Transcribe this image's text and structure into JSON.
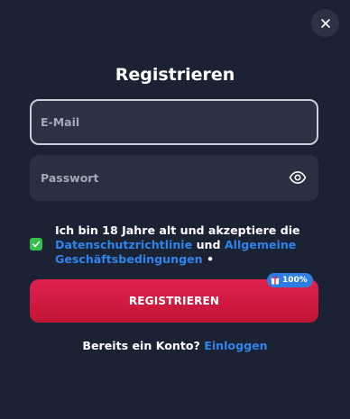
{
  "dialog": {
    "title": "Registrieren",
    "close_icon": "close-icon"
  },
  "form": {
    "email": {
      "placeholder": "E-Mail",
      "value": ""
    },
    "password": {
      "placeholder": "Passwort",
      "value": "",
      "icon": "eye-icon"
    }
  },
  "consent": {
    "checked": true,
    "text_prefix": "Ich bin 18 Jahre alt und akzeptiere die",
    "privacy_link": "Datenschutzrichtlinie",
    "connector": "und",
    "terms_link": "Allgemeine Geschäftsbedingungen",
    "suffix": "•"
  },
  "submit": {
    "label": "REGISTRIEREN",
    "badge": {
      "icon": "gift-icon",
      "text": "100%"
    }
  },
  "footer": {
    "question": "Bereits ein Konto?",
    "login_link": "Einloggen"
  },
  "colors": {
    "background": "#1b2233",
    "field": "#283042",
    "accent_link": "#2e84ea",
    "button": "#d11b43",
    "checkbox": "#35c04b",
    "badge": "#2e7de0"
  }
}
